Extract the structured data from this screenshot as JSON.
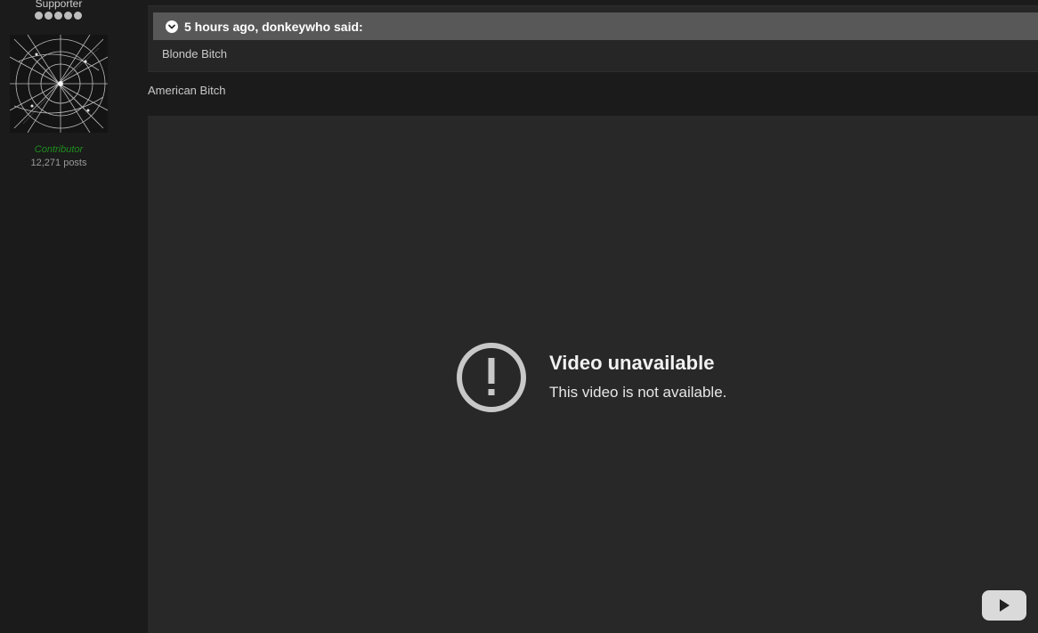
{
  "author": {
    "title": "Supporter",
    "pip_count": 5,
    "group": "Contributor",
    "posts": "12,271 posts",
    "group_color": "#1e8c1e"
  },
  "quote": {
    "citation": "5 hours ago, donkeywho said:",
    "body": "Blonde Bitch"
  },
  "post": {
    "text": "American Bitch"
  },
  "video": {
    "title": "Video unavailable",
    "subtitle": "This video is not available."
  }
}
